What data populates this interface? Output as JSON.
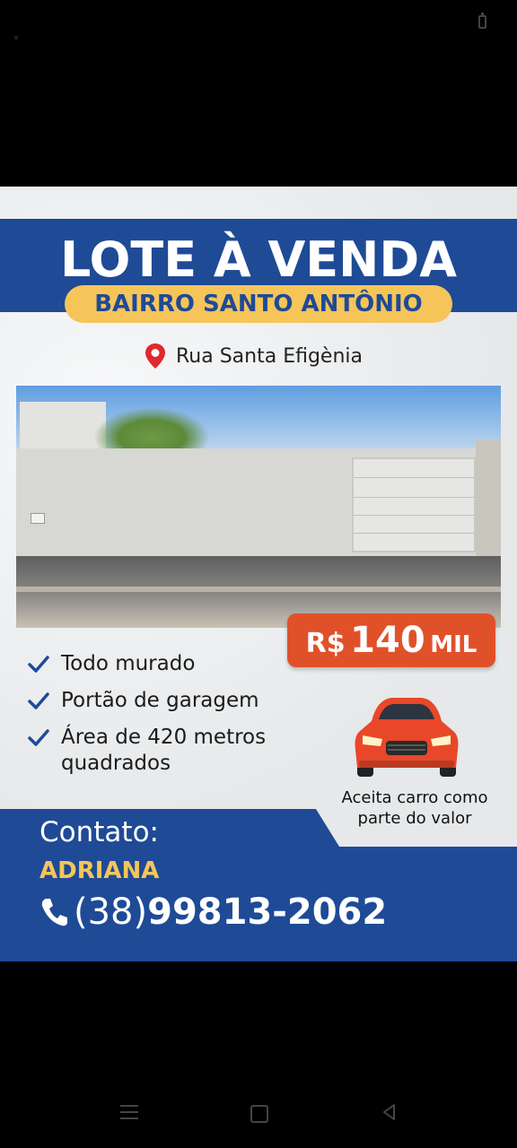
{
  "listing": {
    "title": "LOTE À VENDA",
    "neighborhood": "BAIRRO SANTO ANTÔNIO",
    "street": "Rua Santa Efigènia",
    "price": {
      "currency": "R$",
      "amount": "140",
      "unit": "MIL"
    },
    "features": [
      "Todo murado",
      "Portão de garagem",
      "Área de 420 metros quadrados"
    ],
    "car_offer": "Aceita carro como parte do valor"
  },
  "contact": {
    "label": "Contato:",
    "name": "ADRIANA",
    "phone_area": "(38)",
    "phone_number": "99813-2062"
  },
  "colors": {
    "brand_blue": "#1f4a96",
    "accent_yellow": "#f5c55a",
    "price_orange": "#e0512a"
  },
  "icons": [
    "battery-icon",
    "location-pin-icon",
    "check-icon",
    "car-icon",
    "phone-icon",
    "menu-icon",
    "home-icon",
    "back-icon"
  ]
}
